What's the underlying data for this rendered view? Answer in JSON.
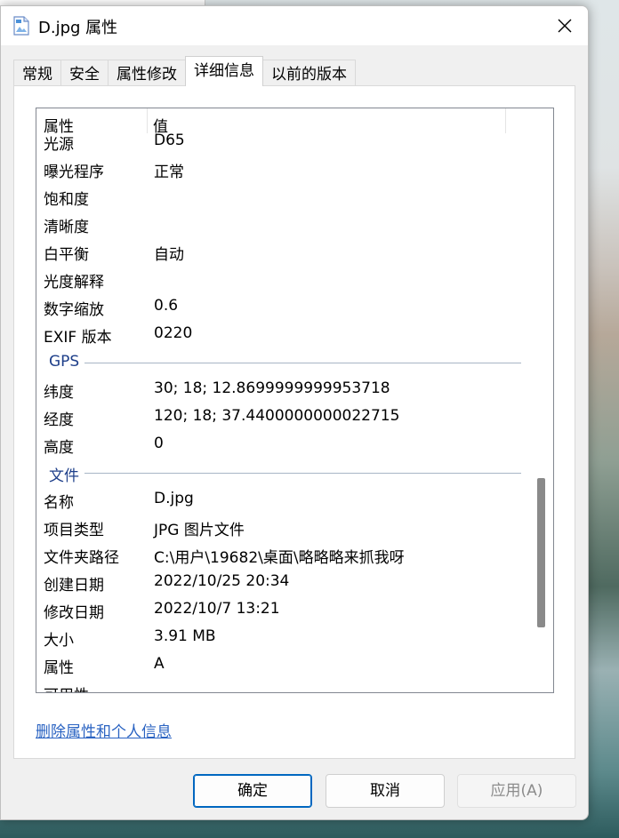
{
  "window": {
    "title": "D.jpg 属性"
  },
  "tabs": [
    {
      "label": "常规"
    },
    {
      "label": "安全"
    },
    {
      "label": "属性修改"
    },
    {
      "label": "详细信息"
    },
    {
      "label": "以前的版本"
    }
  ],
  "details": {
    "header": {
      "name": "属性",
      "value": "值"
    },
    "camera_rows": [
      {
        "k": "光源",
        "v": "D65"
      },
      {
        "k": "曝光程序",
        "v": "正常"
      },
      {
        "k": "饱和度",
        "v": ""
      },
      {
        "k": "清晰度",
        "v": ""
      },
      {
        "k": "白平衡",
        "v": "自动"
      },
      {
        "k": "光度解释",
        "v": ""
      },
      {
        "k": "数字缩放",
        "v": "0.6"
      },
      {
        "k": "EXIF 版本",
        "v": "0220"
      }
    ],
    "gps_group": "GPS",
    "gps_rows": [
      {
        "k": "纬度",
        "v": "30; 18; 12.8699999999953718"
      },
      {
        "k": "经度",
        "v": "120; 18; 37.4400000000022715"
      },
      {
        "k": "高度",
        "v": "0"
      }
    ],
    "file_group": "文件",
    "file_rows": [
      {
        "k": "名称",
        "v": "D.jpg"
      },
      {
        "k": "项目类型",
        "v": "JPG 图片文件"
      },
      {
        "k": "文件夹路径",
        "v": "C:\\用户\\19682\\桌面\\略略略来抓我呀"
      },
      {
        "k": "创建日期",
        "v": "2022/10/25 20:34"
      },
      {
        "k": "修改日期",
        "v": "2022/10/7 13:21"
      },
      {
        "k": "大小",
        "v": "3.91 MB"
      },
      {
        "k": "属性",
        "v": "A"
      }
    ],
    "partial_row": "可用性"
  },
  "links": {
    "remove_properties": "删除属性和个人信息"
  },
  "buttons": {
    "ok": "确定",
    "cancel": "取消",
    "apply": "应用(A)"
  },
  "colors": {
    "accent": "#0067c0",
    "link": "#2a63c2",
    "group_header": "#1e3f8a"
  }
}
